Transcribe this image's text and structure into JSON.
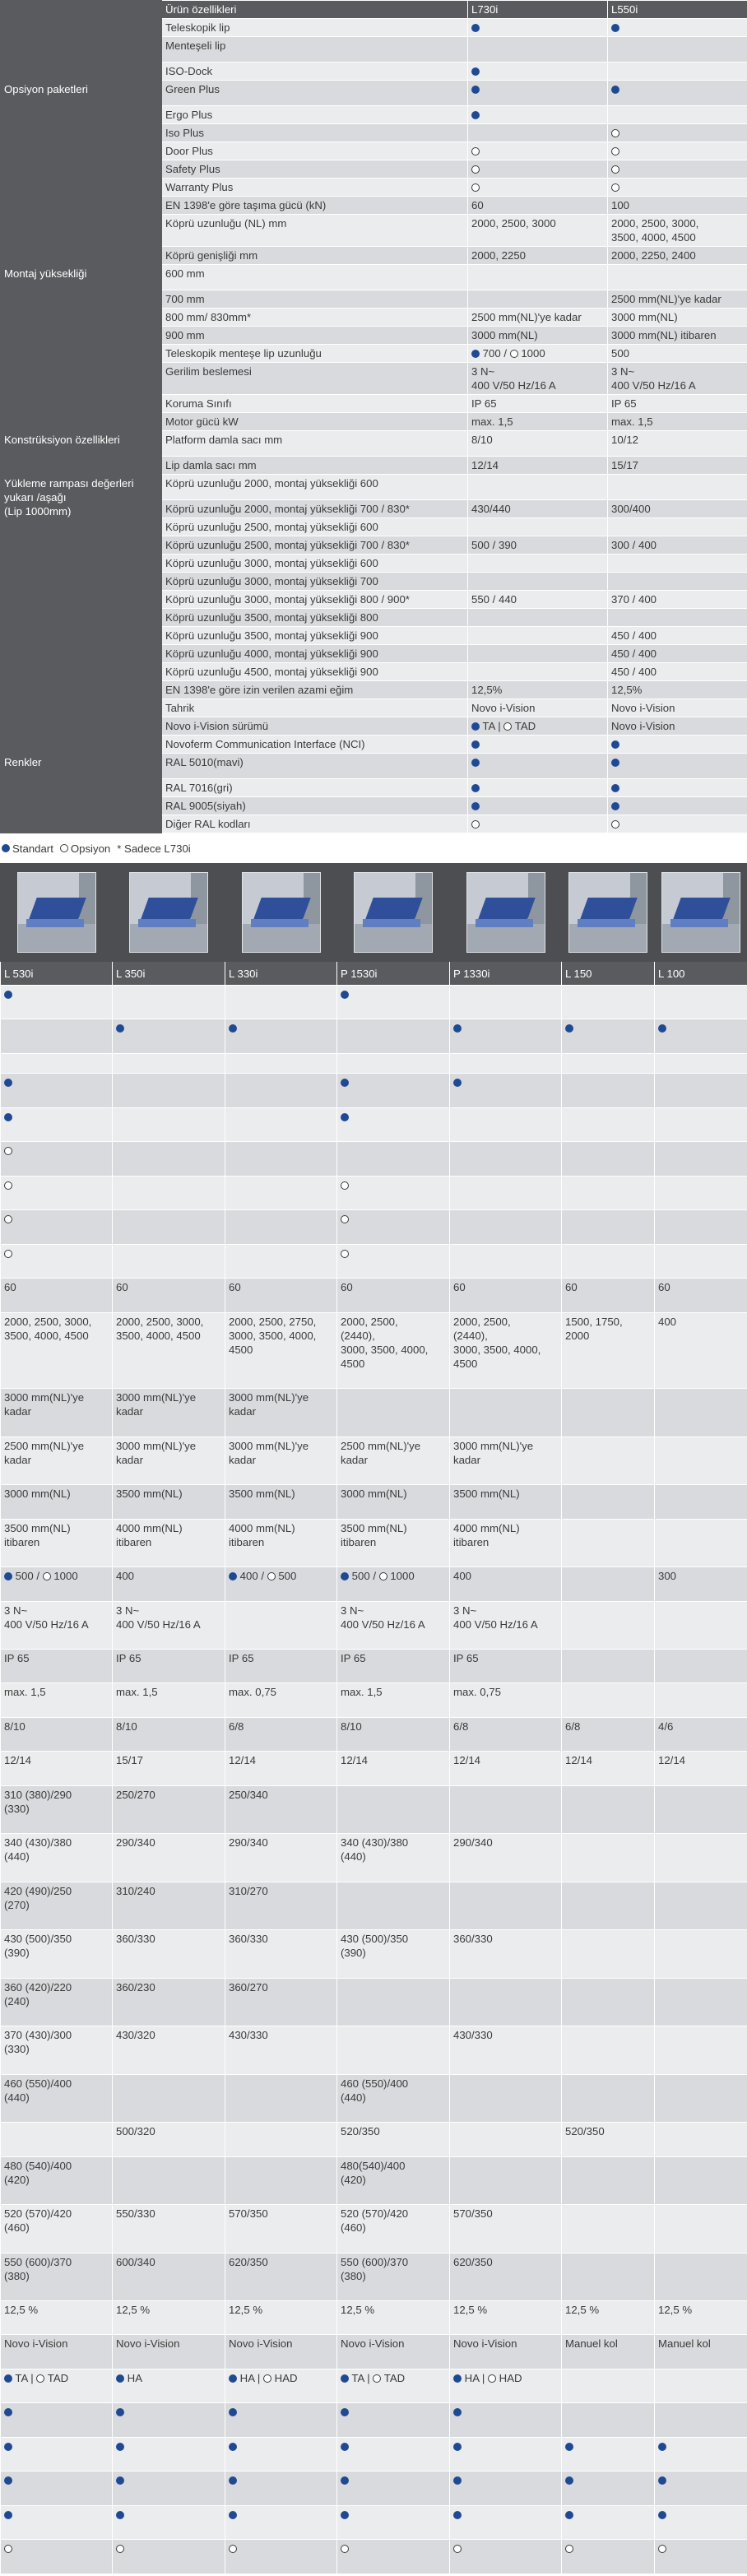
{
  "top_table": {
    "header": [
      "Ürün özellikleri",
      "L730i",
      "L550i"
    ],
    "sections": [
      {
        "category": "",
        "rows": [
          {
            "f": "Teleskopik lip",
            "v": [
              "dot",
              "dot"
            ]
          }
        ]
      },
      {
        "category": "Menteşeli lip",
        "rows": []
      },
      {
        "category": "",
        "rows": [
          {
            "f": "ISO-Dock",
            "v": [
              "dot",
              ""
            ]
          }
        ]
      },
      {
        "category": "Opsiyon paketleri",
        "rows": [
          {
            "f": "Green Plus",
            "v": [
              "dot",
              "dot"
            ]
          },
          {
            "f": "Ergo Plus",
            "v": [
              "dot",
              ""
            ]
          },
          {
            "f": "Iso Plus",
            "v": [
              "",
              "ring"
            ]
          },
          {
            "f": "Door Plus",
            "v": [
              "ring",
              "ring"
            ]
          },
          {
            "f": "Safety Plus",
            "v": [
              "ring",
              "ring"
            ]
          },
          {
            "f": "Warranty Plus",
            "v": [
              "ring",
              "ring"
            ]
          },
          {
            "f": "EN 1398'e göre taşıma gücü (kN)",
            "v": [
              "60",
              "100"
            ]
          },
          {
            "f": "Köprü uzunluğu (NL) mm",
            "v": [
              "2000, 2500, 3000",
              "2000, 2500, 3000,\n3500, 4000, 4500"
            ]
          },
          {
            "f": "Köprü genişliği mm",
            "v": [
              "2000, 2250",
              "2000, 2250, 2400"
            ]
          }
        ]
      },
      {
        "category": "Montaj yüksekliği",
        "rows": [
          {
            "f": "600 mm",
            "v": [
              "",
              ""
            ]
          },
          {
            "f": "700 mm",
            "v": [
              "",
              "2500 mm(NL)'ye kadar"
            ]
          },
          {
            "f": "800 mm/ 830mm*",
            "v": [
              "2500 mm(NL)'ye kadar",
              "3000 mm(NL)"
            ]
          },
          {
            "f": "900 mm",
            "v": [
              "3000 mm(NL)",
              "3000 mm(NL) itibaren"
            ]
          },
          {
            "f": "Teleskopik menteşe lip uzunluğu",
            "v": [
              "dot:700/ring:1000",
              "500"
            ]
          },
          {
            "f": "Gerilim beslemesi",
            "v": [
              "3 N~\n400 V/50 Hz/16 A",
              "3 N~\n400 V/50 Hz/16 A"
            ]
          },
          {
            "f": "Koruma Sınıfı",
            "v": [
              "IP 65",
              "IP 65"
            ]
          },
          {
            "f": "Motor gücü kW",
            "v": [
              "max. 1,5",
              "max. 1,5"
            ]
          }
        ]
      },
      {
        "category": "Konstrüksiyon özellikleri",
        "rows": [
          {
            "f": "Platform damla sacı mm",
            "v": [
              "8/10",
              "10/12"
            ]
          },
          {
            "f": "Lip damla sacı mm",
            "v": [
              "12/14",
              "15/17"
            ]
          }
        ]
      },
      {
        "category": "Yükleme rampası değerleri\nyukarı /aşağı\n(Lip 1000mm)",
        "rows": [
          {
            "f": "Köprü uzunluğu 2000, montaj yüksekliği 600",
            "v": [
              "",
              ""
            ]
          },
          {
            "f": "Köprü uzunluğu 2000, montaj yüksekliği 700 / 830*",
            "v": [
              "430/440",
              "300/400"
            ]
          },
          {
            "f": "Köprü uzunluğu 2500, montaj yüksekliği 600",
            "v": [
              "",
              ""
            ]
          },
          {
            "f": "Köprü uzunluğu 2500, montaj yüksekliği 700 / 830*",
            "v": [
              "500 / 390",
              "300 / 400"
            ]
          },
          {
            "f": "Köprü uzunluğu 3000, montaj yüksekliği 600",
            "v": [
              "",
              ""
            ]
          },
          {
            "f": "Köprü uzunluğu 3000, montaj yüksekliği 700",
            "v": [
              "",
              ""
            ]
          },
          {
            "f": "Köprü uzunluğu 3000, montaj yüksekliği 800 / 900*",
            "v": [
              "550 / 440",
              "370 / 400"
            ]
          },
          {
            "f": "Köprü uzunluğu 3500, montaj yüksekliği 800",
            "v": [
              "",
              ""
            ]
          },
          {
            "f": "Köprü uzunluğu 3500, montaj yüksekliği 900",
            "v": [
              "",
              "450 / 400"
            ]
          },
          {
            "f": "Köprü uzunluğu 4000, montaj yüksekliği 900",
            "v": [
              "",
              "450 / 400"
            ]
          },
          {
            "f": "Köprü uzunluğu 4500, montaj yüksekliği 900",
            "v": [
              "",
              "450 / 400"
            ]
          },
          {
            "f": "EN 1398'e göre izin verilen azami eğim",
            "v": [
              "12,5%",
              "12,5%"
            ]
          },
          {
            "f": "Tahrik",
            "v": [
              "Novo i-Vision",
              "Novo i-Vision"
            ]
          },
          {
            "f": "Novo i-Vision sürümü",
            "v": [
              "dot:TA | ring:TAD",
              "Novo i-Vision"
            ]
          },
          {
            "f": "Novoferm Communication Interface (NCI)",
            "v": [
              "dot",
              "dot"
            ]
          }
        ]
      },
      {
        "category": "Renkler",
        "rows": [
          {
            "f": "RAL 5010(mavi)",
            "v": [
              "dot",
              "dot"
            ]
          },
          {
            "f": "RAL 7016(gri)",
            "v": [
              "dot",
              "dot"
            ]
          },
          {
            "f": "RAL 9005(siyah)",
            "v": [
              "dot",
              "dot"
            ]
          },
          {
            "f": "Diğer RAL kodları",
            "v": [
              "ring",
              "ring"
            ]
          }
        ]
      }
    ]
  },
  "legend": {
    "standard": "Standart",
    "option": "Opsiyon",
    "note": "* Sadece L730i"
  },
  "bottom_table": {
    "products": [
      "L 530i",
      "L 350i",
      "L 330i",
      "P 1530i",
      "P 1330i",
      "L 150",
      "L 100"
    ],
    "rows": [
      [
        "dot",
        "",
        "",
        "dot",
        "",
        "",
        ""
      ],
      [
        "",
        "dot",
        "dot",
        "",
        "dot",
        "dot",
        "dot"
      ],
      [
        "",
        "",
        "",
        "",
        "",
        "",
        ""
      ],
      [
        "dot",
        "",
        "",
        "dot",
        "dot",
        "",
        ""
      ],
      [
        "dot",
        "",
        "",
        "dot",
        "",
        "",
        ""
      ],
      [
        "ring",
        "",
        "",
        "",
        "",
        "",
        ""
      ],
      [
        "ring",
        "",
        "",
        "ring",
        "",
        "",
        ""
      ],
      [
        "ring",
        "",
        "",
        "ring",
        "",
        "",
        ""
      ],
      [
        "ring",
        "",
        "",
        "ring",
        "",
        "",
        ""
      ],
      [
        "60",
        "60",
        "60",
        "60",
        "60",
        "60",
        "60"
      ],
      [
        "2000, 2500, 3000,\n3500, 4000, 4500",
        "2000, 2500, 3000,\n3500, 4000, 4500",
        "2000, 2500, 2750,\n3000, 3500, 4000,\n4500",
        "2000, 2500,\n(2440),\n3000, 3500, 4000,\n4500",
        "2000, 2500,\n(2440),\n3000, 3500, 4000,\n4500",
        "1500, 1750,\n2000",
        "400"
      ],
      [
        "3000 mm(NL)'ye\nkadar",
        "3000 mm(NL)'ye\nkadar",
        "3000 mm(NL)'ye\nkadar",
        "",
        "",
        "",
        ""
      ],
      [
        "2500 mm(NL)'ye\nkadar",
        "3000 mm(NL)'ye\nkadar",
        "3000 mm(NL)'ye\nkadar",
        "2500 mm(NL)'ye\nkadar",
        "3000 mm(NL)'ye\nkadar",
        "",
        ""
      ],
      [
        "3000 mm(NL)",
        "3500 mm(NL)",
        "3500 mm(NL)",
        "3000 mm(NL)",
        "3500 mm(NL)",
        "",
        ""
      ],
      [
        "3500 mm(NL)\nitibaren",
        "4000 mm(NL)\nitibaren",
        "4000 mm(NL)\nitibaren",
        "3500 mm(NL)\nitibaren",
        "4000 mm(NL)\nitibaren",
        "",
        ""
      ],
      [
        "dot:500/ring:1000",
        "400",
        "dot:400/ring:500",
        "dot:500/ring:1000",
        "400",
        "",
        "300"
      ],
      [
        "3 N~\n400 V/50 Hz/16 A",
        "3 N~\n400 V/50 Hz/16 A",
        "",
        "3 N~\n400 V/50 Hz/16 A",
        "3 N~\n400 V/50 Hz/16 A",
        "",
        ""
      ],
      [
        "IP 65",
        "IP 65",
        "IP 65",
        "IP 65",
        "IP 65",
        "",
        ""
      ],
      [
        "max. 1,5",
        "max. 1,5",
        "max. 0,75",
        "max. 1,5",
        "max. 0,75",
        "",
        ""
      ],
      [
        "8/10",
        "8/10",
        "6/8",
        "8/10",
        "6/8",
        "6/8",
        "4/6"
      ],
      [
        "12/14",
        "15/17",
        "12/14",
        "12/14",
        "12/14",
        "12/14",
        "12/14"
      ],
      [
        "310 (380)/290\n(330)",
        "250/270",
        "250/340",
        "",
        "",
        "",
        ""
      ],
      [
        "340 (430)/380\n(440)",
        "290/340",
        "290/340",
        "340 (430)/380\n(440)",
        "290/340",
        "",
        ""
      ],
      [
        "420 (490)/250\n(270)",
        "310/240",
        "310/270",
        "",
        "",
        "",
        ""
      ],
      [
        "430 (500)/350\n(390)",
        "360/330",
        "360/330",
        "430 (500)/350\n(390)",
        "360/330",
        "",
        ""
      ],
      [
        "360 (420)/220\n(240)",
        "360/230",
        "360/270",
        "",
        "",
        "",
        ""
      ],
      [
        "370 (430)/300\n(330)",
        "430/320",
        "430/330",
        "",
        "430/330",
        "",
        ""
      ],
      [
        "460 (550)/400\n(440)",
        "",
        "",
        "460 (550)/400\n(440)",
        "",
        "",
        ""
      ],
      [
        "",
        "500/320",
        "",
        "520/350",
        "",
        "520/350",
        ""
      ],
      [
        "480 (540)/400\n(420)",
        "",
        "",
        "480(540)/400\n(420)",
        "",
        "",
        ""
      ],
      [
        "520 (570)/420\n(460)",
        "550/330",
        "570/350",
        "520 (570)/420\n(460)",
        "570/350",
        "",
        ""
      ],
      [
        "550 (600)/370\n(380)",
        "600/340",
        "620/350",
        "550 (600)/370\n(380)",
        "620/350",
        "",
        ""
      ],
      [
        "12,5 %",
        "12,5 %",
        "12,5 %",
        "12,5 %",
        "12,5 %",
        "12,5 %",
        "12,5 %"
      ],
      [
        "Novo i-Vision",
        "Novo i-Vision",
        "Novo i-Vision",
        "Novo i-Vision",
        "Novo i-Vision",
        "Manuel kol",
        "Manuel kol"
      ],
      [
        "dot:TA | ring:TAD",
        "dot:HA",
        "dot:HA | ring:HAD",
        "dot:TA | ring:TAD",
        "dot:HA | ring:HAD",
        "",
        ""
      ],
      [
        "dot",
        "dot",
        "dot",
        "dot",
        "dot",
        "",
        ""
      ],
      [
        "dot",
        "dot",
        "dot",
        "dot",
        "dot",
        "dot",
        "dot"
      ],
      [
        "dot",
        "dot",
        "dot",
        "dot",
        "dot",
        "dot",
        "dot"
      ],
      [
        "dot",
        "dot",
        "dot",
        "dot",
        "dot",
        "dot",
        "dot"
      ],
      [
        "ring",
        "ring",
        "ring",
        "ring",
        "ring",
        "ring",
        "ring"
      ]
    ]
  }
}
